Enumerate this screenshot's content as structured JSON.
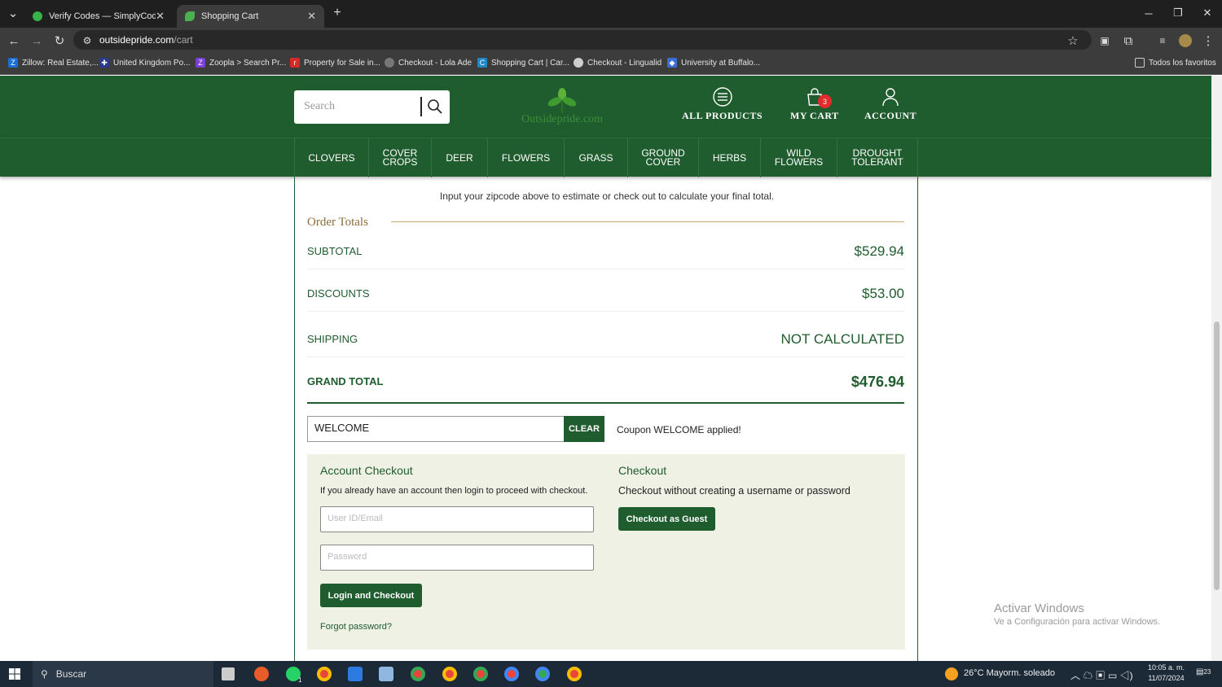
{
  "browser": {
    "tabs": [
      {
        "label": "Verify Codes — SimplyCodes",
        "close": "✕"
      },
      {
        "label": "Shopping Cart",
        "close": "✕"
      }
    ],
    "new_tab": "+",
    "url_host": "outsidepride.com",
    "url_path": "/cart",
    "bookmarks": [
      "Zillow: Real Estate,...",
      "United Kingdom Po...",
      "Zoopla > Search Pr...",
      "Property for Sale in...",
      "Checkout - Lola Ade",
      "Shopping Cart | Car...",
      "Checkout - Lingualid",
      "University at Buffalo..."
    ],
    "all_bookmarks": "Todos los favoritos"
  },
  "header": {
    "search_placeholder": "Search",
    "logo_text": "Outsidepride.com",
    "all_products": "ALL PRODUCTS",
    "my_cart": "MY CART",
    "cart_count": "3",
    "account": "ACCOUNT"
  },
  "categories": [
    "CLOVERS",
    "COVER CROPS",
    "DEER",
    "FLOWERS",
    "GRASS",
    "GROUND COVER",
    "HERBS",
    "WILD FLOWERS",
    "DROUGHT TOLERANT"
  ],
  "cart": {
    "zip_note": "Input your zipcode above to estimate or check out to calculate your final total.",
    "order_totals_title": "Order Totals",
    "subtotal_label": "SUBTOTAL",
    "subtotal_value": "$529.94",
    "discounts_label": "DISCOUNTS",
    "discounts_value": "$53.00",
    "shipping_label": "SHIPPING",
    "shipping_value": "NOT CALCULATED",
    "grand_total_label": "GRAND TOTAL",
    "grand_total_value": "$476.94",
    "coupon_value": "WELCOME",
    "clear_label": "CLEAR",
    "coupon_message": "Coupon WELCOME applied!"
  },
  "checkout": {
    "account_title": "Account Checkout",
    "account_text": "If you already have an account then login to proceed with checkout.",
    "user_placeholder": "User ID/Email",
    "password_placeholder": "Password",
    "login_button": "Login and Checkout",
    "forgot": "Forgot password?",
    "guest_title": "Checkout",
    "guest_text": "Checkout without creating a username or password",
    "guest_button": "Checkout as Guest"
  },
  "watermark": {
    "line1": "Activar Windows",
    "line2": "Ve a Configuración para activar Windows."
  },
  "taskbar": {
    "search": "Buscar",
    "weather": "26°C  Mayorm. soleado",
    "time": "10:05 a. m.",
    "date": "11/07/2024",
    "whatsapp_count": "1",
    "notif_count": "23"
  },
  "colors": {
    "brand_green": "#1f5c2e",
    "badge_red": "#e32b2b",
    "gold_line": "#c9a96b"
  }
}
